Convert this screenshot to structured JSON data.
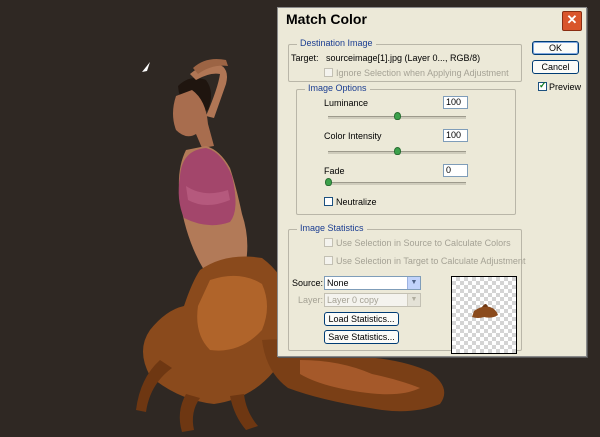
{
  "dialog": {
    "title": "Match Color",
    "buttons": {
      "ok": "OK",
      "cancel": "Cancel"
    },
    "preview": {
      "label": "Preview",
      "checked": true
    }
  },
  "destination": {
    "group_title": "Destination Image",
    "target_label": "Target:",
    "target_value": "sourceimage[1].jpg (Layer 0..., RGB/8)",
    "ignore_selection_label": "Ignore Selection when Applying Adjustment"
  },
  "options": {
    "group_title": "Image Options",
    "luminance": {
      "label": "Luminance",
      "value": "100",
      "level": 100,
      "range": [
        1,
        200
      ]
    },
    "intensity": {
      "label": "Color Intensity",
      "value": "100",
      "level": 100,
      "range": [
        1,
        200
      ]
    },
    "fade": {
      "label": "Fade",
      "value": "0",
      "level": 0,
      "range": [
        0,
        100
      ]
    },
    "neutralize": {
      "label": "Neutralize",
      "checked": false
    }
  },
  "statistics": {
    "group_title": "Image Statistics",
    "use_source_label": "Use Selection in Source to Calculate Colors",
    "use_target_label": "Use Selection in Target to Calculate Adjustment",
    "source_label": "Source:",
    "source_value": "None",
    "layer_label": "Layer:",
    "layer_value": "Layer 0 copy",
    "load_label": "Load Statistics...",
    "save_label": "Save Statistics..."
  }
}
